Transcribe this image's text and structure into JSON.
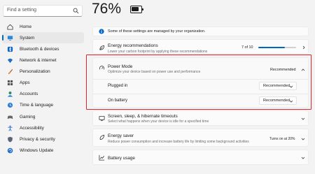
{
  "search": {
    "placeholder": "Find a setting"
  },
  "sidebar": {
    "items": [
      {
        "label": "Home",
        "icon": "home-icon",
        "active": false
      },
      {
        "label": "System",
        "icon": "system-icon",
        "active": true
      },
      {
        "label": "Bluetooth & devices",
        "icon": "bluetooth-icon",
        "active": false
      },
      {
        "label": "Network & internet",
        "icon": "wifi-icon",
        "active": false
      },
      {
        "label": "Personalization",
        "icon": "brush-icon",
        "active": false
      },
      {
        "label": "Apps",
        "icon": "apps-icon",
        "active": false
      },
      {
        "label": "Accounts",
        "icon": "account-icon",
        "active": false
      },
      {
        "label": "Time & language",
        "icon": "globe-clock-icon",
        "active": false
      },
      {
        "label": "Gaming",
        "icon": "controller-icon",
        "active": false
      },
      {
        "label": "Accessibility",
        "icon": "accessibility-icon",
        "active": false
      },
      {
        "label": "Privacy & security",
        "icon": "shield-icon",
        "active": false
      },
      {
        "label": "Windows Update",
        "icon": "update-icon",
        "active": false
      }
    ]
  },
  "header": {
    "battery_percent": "76%",
    "battery_level": 0.76
  },
  "notice": {
    "text": "Some of these settings are managed by your organization."
  },
  "energy": {
    "title": "Energy recommendations",
    "subtitle": "Lower your carbon footprint by applying these recommendations",
    "progress_text": "7 of 10",
    "progress": 0.7
  },
  "power_mode": {
    "title": "Power Mode",
    "subtitle": "Optimize your device based on power use and performance",
    "value": "Recommended",
    "plugged_in": {
      "label": "Plugged in",
      "value": "Recommended"
    },
    "on_battery": {
      "label": "On battery",
      "value": "Recommended"
    }
  },
  "screen_sleep": {
    "title": "Screen, sleep, & hibernate timeouts",
    "subtitle": "Select what happens when your device is idle for a specified time"
  },
  "energy_saver": {
    "title": "Energy saver",
    "subtitle": "Reduce power consumption and increase battery life by limiting some background activities",
    "status": "Turns on at 20%"
  },
  "battery_usage": {
    "title": "Battery usage"
  },
  "colors": {
    "accent": "#0067c0",
    "highlight": "#e0262c"
  }
}
